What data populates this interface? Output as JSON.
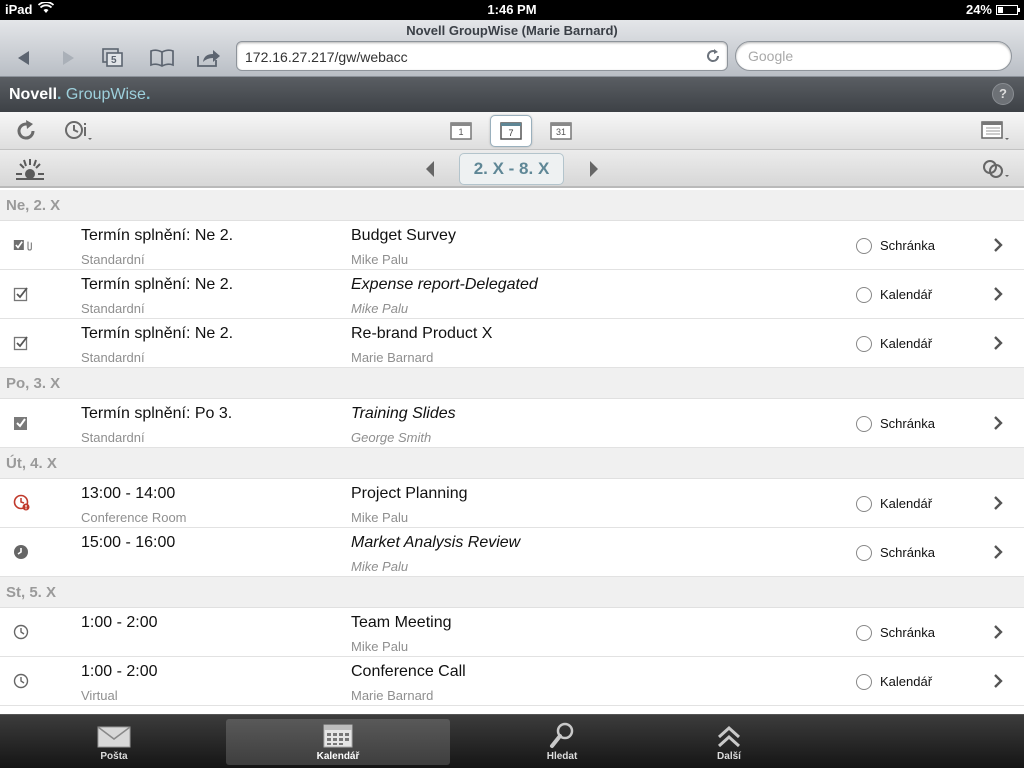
{
  "status_bar": {
    "device": "iPad",
    "time": "1:46 PM",
    "battery": "24%"
  },
  "browser": {
    "page_title": "Novell GroupWise (Marie Barnard)",
    "url": "172.16.27.217/gw/webacc",
    "search_placeholder": "Google",
    "tabs_count": "5"
  },
  "app_header": {
    "brand_novell": "Novell",
    "brand_dot": ".",
    "brand_groupwise": "GroupWise",
    "help_label": "?"
  },
  "view_buttons": {
    "day": "1",
    "week": "7",
    "month": "31"
  },
  "date_range": "2. X - 8. X",
  "days": [
    {
      "header": "Ne, 2. X",
      "items": [
        {
          "icon": "task-attachment-icon",
          "when": "Termín splnění: Ne 2.",
          "sub": "Standardní",
          "subject": "Budget Survey",
          "from": "Mike Palu",
          "italic": false,
          "folder": "Schránka"
        },
        {
          "icon": "task-checkbox-icon",
          "when": "Termín splnění: Ne 2.",
          "sub": "Standardní",
          "subject": "Expense report-Delegated",
          "from": "Mike Palu",
          "italic": true,
          "folder": "Kalendář"
        },
        {
          "icon": "task-checkbox-icon",
          "when": "Termín splnění: Ne 2.",
          "sub": "Standardní",
          "subject": "Re-brand Product X",
          "from": "Marie Barnard",
          "italic": false,
          "folder": "Kalendář"
        }
      ]
    },
    {
      "header": "Po, 3. X",
      "items": [
        {
          "icon": "task-filled-icon",
          "when": "Termín splnění: Po 3.",
          "sub": "Standardní",
          "subject": "Training Slides",
          "from": "George Smith",
          "italic": true,
          "folder": "Schránka"
        }
      ]
    },
    {
      "header": "Út, 4. X",
      "items": [
        {
          "icon": "clock-alert-icon",
          "when": "13:00 - 14:00",
          "sub": "Conference Room",
          "subject": "Project Planning",
          "from": "Mike Palu",
          "italic": false,
          "folder": "Kalendář"
        },
        {
          "icon": "clock-filled-icon",
          "when": "15:00 - 16:00",
          "sub": "",
          "subject": "Market Analysis Review",
          "from": "Mike Palu",
          "italic": true,
          "folder": "Schránka"
        }
      ]
    },
    {
      "header": "St, 5. X",
      "items": [
        {
          "icon": "clock-icon",
          "when": "1:00 - 2:00",
          "sub": "",
          "subject": "Team Meeting",
          "from": "Mike Palu",
          "italic": false,
          "folder": "Schránka"
        },
        {
          "icon": "clock-icon",
          "when": "1:00 - 2:00",
          "sub": "Virtual",
          "subject": "Conference Call",
          "from": "Marie Barnard",
          "italic": false,
          "folder": "Kalendář"
        }
      ]
    }
  ],
  "tab_bar": [
    {
      "label": "Pošta",
      "icon": "mail-icon",
      "active": false
    },
    {
      "label": "Kalendář",
      "icon": "calendar-icon",
      "active": true
    },
    {
      "label": "Hledat",
      "icon": "search-icon",
      "active": false
    },
    {
      "label": "Další",
      "icon": "more-icon",
      "active": false
    }
  ]
}
